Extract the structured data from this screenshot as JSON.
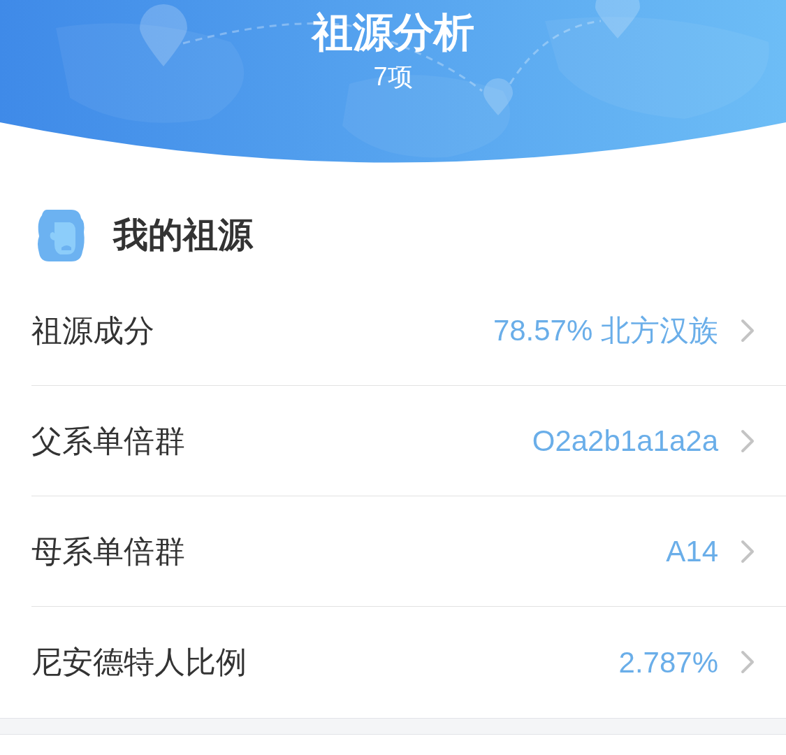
{
  "header": {
    "title": "祖源分析",
    "subtitle": "7项"
  },
  "section": {
    "title": "我的祖源"
  },
  "rows": [
    {
      "label": "祖源成分",
      "value": "78.57% 北方汉族"
    },
    {
      "label": "父系单倍群",
      "value": "O2a2b1a1a2a"
    },
    {
      "label": "母系单倍群",
      "value": "A14"
    },
    {
      "label": "尼安德特人比例",
      "value": "2.787%"
    }
  ]
}
